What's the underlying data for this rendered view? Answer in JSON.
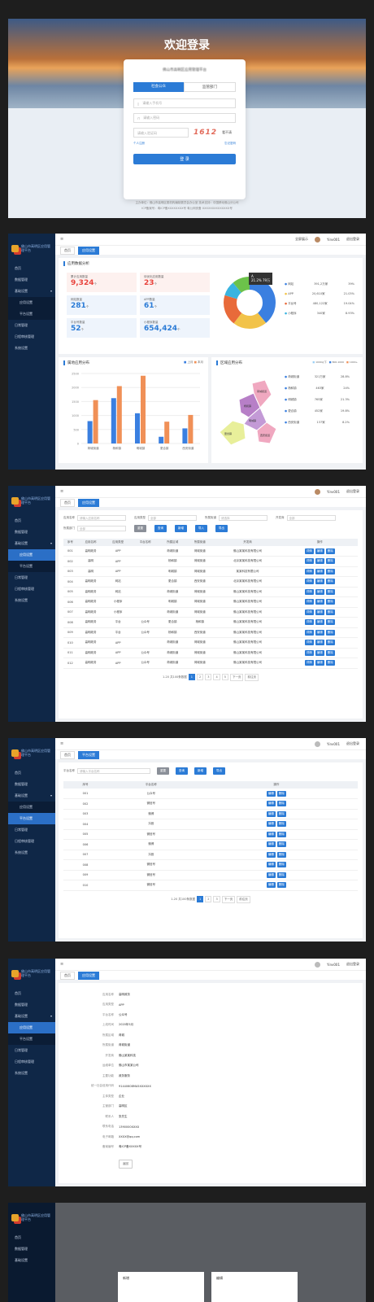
{
  "login": {
    "title": "欢迎登录",
    "platform": "佛山市高明区应用管理平台",
    "tab_a": "社会公众",
    "tab_b": "监管部门",
    "user_ph": "请输入手机号",
    "pwd_ph": "请输入密码",
    "code_ph": "请输入验证码",
    "captcha": "1612",
    "refresh": "看不清",
    "register": "个人注册",
    "reset": "忘记密码",
    "submit": "登 录",
    "footer1": "主办单位：佛山市高明区委机构编制委员会办公室  技术支持：中国移动佛山分公司",
    "footer2": "ICP备案号：粤ICP备XXXXXXXX号  粤公网安备 XXXXXXXXXXXXXX号"
  },
  "side": {
    "logo": "佛山市高明区应用管理平台",
    "items": [
      "首页",
      "数据管理",
      "基础设置",
      "应用设置",
      "平台设置",
      "日常管理",
      "日程审核管理",
      "系统设置"
    ]
  },
  "top": {
    "fullscreen": "全屏展示",
    "user": "Yinv001",
    "logout": "退出登录"
  },
  "tabs": {
    "home": "首页",
    "list": "应用设置",
    "platform": "平台设置"
  },
  "dash": {
    "section": "应用数据分析",
    "cards": [
      {
        "label": "累计应用数量",
        "value": "9,324",
        "unit": "个",
        "color": "#e8433c"
      },
      {
        "label": "待优化应用数量",
        "value": "23",
        "unit": "个",
        "color": "#e8433c"
      },
      {
        "label": "网站数量",
        "value": "281",
        "unit": "个",
        "color": "#2b7bd6"
      },
      {
        "label": "APP数量",
        "value": "61",
        "unit": "个",
        "color": "#2b7bd6"
      },
      {
        "label": "平台号数量",
        "value": "52",
        "unit": "个",
        "color": "#2b7bd6"
      },
      {
        "label": "小程序数量",
        "value": "654,424",
        "unit": "个",
        "color": "#2b7bd6"
      }
    ],
    "pie_tip_label": "A",
    "pie_tip_value": "21.2%  79万",
    "legend": [
      {
        "name": "网站",
        "count": "391,2万家",
        "pct": "39%",
        "color": "#3a7fe0"
      },
      {
        "name": "APP",
        "count": "20,610家",
        "pct": "21.03%",
        "color": "#f2c34a"
      },
      {
        "name": "平台号",
        "count": "480,122家",
        "pct": "19.04%",
        "color": "#e86a3a"
      },
      {
        "name": "小程序",
        "count": "340家",
        "pct": "8.93%",
        "color": "#3ab4e0"
      }
    ],
    "bar_title": "属地应用分布",
    "region_title": "区域应用分布",
    "region_list": [
      {
        "name": "荷城街道",
        "count": "321万家",
        "pct": "28.8%"
      },
      {
        "name": "杨和镇",
        "count": "463家",
        "pct": "24%"
      },
      {
        "name": "明城镇",
        "count": "765家",
        "pct": "21.3%"
      },
      {
        "name": "更合镇",
        "count": "452家",
        "pct": "19.8%"
      },
      {
        "name": "西安街道",
        "count": "137家",
        "pct": "8.2%"
      }
    ],
    "map_labels": [
      "更合镇",
      "杨和镇",
      "明城镇",
      "荷城街道",
      "西安街道"
    ],
    "scale_labels": [
      "1000以下",
      "800-1000",
      "1000+"
    ]
  },
  "chart_data": {
    "type": "bar",
    "categories": [
      "荷城街道",
      "杨和镇",
      "明城镇",
      "更合镇",
      "西安街道"
    ],
    "series": [
      {
        "name": "上月",
        "values": [
          800,
          1620,
          1080,
          240,
          540
        ],
        "color": "#3a7fe0"
      },
      {
        "name": "本月",
        "values": [
          1550,
          2050,
          2420,
          780,
          1020
        ],
        "color": "#f09057"
      }
    ],
    "ylim": [
      0,
      2500
    ],
    "yticks": [
      "2500",
      "2000",
      "1500",
      "1000",
      "500",
      "0"
    ]
  },
  "list": {
    "filters": [
      "应用名称",
      "请输入应用名称",
      "应用类型",
      "全部",
      "所属街道",
      "请选择",
      "开发商",
      "全部",
      "所属部门",
      "全部"
    ],
    "buttons": [
      "重置",
      "查询",
      "新增",
      "导入",
      "导出"
    ],
    "headers": [
      "序号",
      "应用名称",
      "应用类型",
      "平台名称",
      "所属区域",
      "所属街道",
      "开发商",
      "操作"
    ],
    "rows": [
      [
        "001",
        "高明政务",
        "APP",
        "",
        "荷城街道",
        "荷城街道",
        "佛山某某科技有限公司"
      ],
      [
        "002",
        "高明",
        "APP",
        "",
        "杨和镇",
        "荷城街道",
        "北京某某科技有限公司"
      ],
      [
        "003",
        "高明",
        "APP",
        "",
        "明城镇",
        "荷城街道",
        "某某科技有限公司"
      ],
      [
        "004",
        "高明政务",
        "网站",
        "",
        "更合镇",
        "西安街道",
        "北京某某科技有限公司"
      ],
      [
        "005",
        "高明政务",
        "网站",
        "",
        "荷城街道",
        "荷城街道",
        "佛山某某科技有限公司"
      ],
      [
        "006",
        "高明政务",
        "小程序",
        "",
        "明城镇",
        "荷城街道",
        "佛山某某科技有限公司"
      ],
      [
        "007",
        "高明政务",
        "小程序",
        "",
        "荷城街道",
        "荷城街道",
        "佛山某某科技有限公司"
      ],
      [
        "008",
        "高明政务",
        "平台",
        "公众号",
        "更合镇",
        "杨和镇",
        "佛山某某科技有限公司"
      ],
      [
        "009",
        "高明政务",
        "平台",
        "公众号",
        "杨和镇",
        "西安街道",
        "佛山某某科技有限公司"
      ],
      [
        "010",
        "高明政务",
        "APP",
        "",
        "荷城街道",
        "荷城街道",
        "佛山某某科技有限公司"
      ],
      [
        "011",
        "高明政务",
        "APP",
        "公众号",
        "荷城街道",
        "荷城街道",
        "佛山某某科技有限公司"
      ],
      [
        "012",
        "高明政务",
        "APP",
        "公众号",
        "荷城街道",
        "荷城街道",
        "佛山某某科技有限公司"
      ]
    ],
    "ops": [
      "详情",
      "编辑",
      "删除"
    ],
    "pager_total": "1-20 共100条数据",
    "pages": [
      "1",
      "2",
      "3",
      "4",
      "5"
    ],
    "next": "下一页",
    "jump": "前往页"
  },
  "plat": {
    "filter_label": "平台名称",
    "filter_ph": "请输入平台名称",
    "buttons": [
      "重置",
      "查询",
      "新增",
      "导出"
    ],
    "headers": [
      "序号",
      "平台名称",
      "操作"
    ],
    "rows": [
      [
        "001",
        "公众号"
      ],
      [
        "002",
        "微信号"
      ],
      [
        "003",
        "微博"
      ],
      [
        "004",
        "抖音"
      ],
      [
        "005",
        "微信号"
      ],
      [
        "006",
        "微博"
      ],
      [
        "007",
        "抖音"
      ],
      [
        "008",
        "微信号"
      ],
      [
        "009",
        "微信号"
      ],
      [
        "010",
        "微信号"
      ]
    ],
    "ops": [
      "编辑",
      "删除"
    ]
  },
  "detail": {
    "fields": [
      [
        "应用名称",
        "高明政务"
      ],
      [
        "应用类型",
        "APP"
      ],
      [
        "平台名称",
        "公众号"
      ],
      [
        "上线时间",
        "2020年5月"
      ],
      [
        "所属区域",
        "荷城"
      ],
      [
        "所属街道",
        "荷城街道"
      ],
      [
        "开发商",
        "佛山某某科技"
      ],
      [
        "运维单位",
        "佛山市某某公司"
      ],
      [
        "主要功能",
        "政务服务"
      ],
      [
        "统一社会信用代码",
        "91440608MA5XXXXXX"
      ],
      [
        "主体类型",
        "企业"
      ],
      [
        "主管部门",
        "高明区"
      ],
      [
        "联系人",
        "张先生"
      ],
      [
        "联系电话",
        "1390000XXXX"
      ],
      [
        "电子邮箱",
        "XXXX@qq.com"
      ],
      [
        "备案编号",
        "粤ICP备XXXXX号"
      ]
    ],
    "back": "返回"
  },
  "modal": {
    "a": "新增",
    "b": "编辑"
  }
}
